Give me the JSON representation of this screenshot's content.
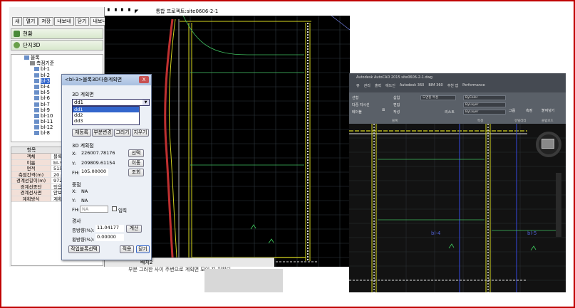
{
  "left_app": {
    "toolbar": [
      "새",
      "열기",
      "저장",
      "내보내",
      "닫기",
      "내보내기"
    ],
    "tab_current": "현황",
    "tab_3d": "단지3D",
    "tree_root": "블록",
    "tree_base": "측점기준",
    "tree_items": [
      "bl-1",
      "bl-2",
      "bl-3",
      "bl-4",
      "bl-5",
      "bl-6",
      "bl-7",
      "bl-9",
      "bl-10",
      "bl-11",
      "bl-12",
      "bl-8"
    ],
    "tree_selected": "bl-3",
    "props_header": {
      "key": "항목",
      "value": ""
    },
    "props": [
      {
        "k": "객체",
        "v": "블록"
      },
      {
        "k": "이름",
        "v": "bl-3"
      },
      {
        "k": "면적",
        "v": "5154"
      },
      {
        "k": "측점간격(m)",
        "v": "20.0"
      },
      {
        "k": "경계선길이(m)",
        "v": "972."
      },
      {
        "k": "경계선종단",
        "v": "있음"
      },
      {
        "k": "경계선사면",
        "v": "안보"
      },
      {
        "k": "계획방식",
        "v": "계획"
      }
    ]
  },
  "cad": {
    "title": "통합 프로젝트:site0606-2-1",
    "bottom_tab": "배치2",
    "under_text": "부분   그러한  사이 주변으로 계획면 모이 지 원하다"
  },
  "dialog": {
    "title": "<bl-3>블록3D다중계획면",
    "close": "X",
    "section_plan": "3D 계획면",
    "combo_value": "dd1",
    "list_items": [
      "dd1",
      "dd2",
      "dd3"
    ],
    "list_selected": "dd1",
    "btn_register": "재등록",
    "btn_partial": "부분변경",
    "btn_draw": "그리기",
    "btn_delete": "지우기",
    "section_point": "3D 계획점",
    "x_label": "X:",
    "x_value": "226007.78176",
    "btn_select": "선택",
    "y_label": "Y:",
    "y_value": "209809.61154",
    "btn_move": "이동",
    "fh_label": "FH:",
    "fh_value": "105.00000",
    "btn_view": "조회",
    "section_center": "중점",
    "cx_label": "X:",
    "cx_value": "NA",
    "cy_label": "Y:",
    "cy_value": "NA",
    "cfh_label": "FH:",
    "cfh_value": "NA",
    "input_label": "입력",
    "section_slope": "경사",
    "slope_v_label": "종방향(%):",
    "slope_v_value": "11.04177",
    "btn_calc": "계산",
    "slope_h_label": "횡방향(%):",
    "slope_h_value": "0.00000",
    "btn_work": "작업블록선택",
    "btn_apply": "적용",
    "btn_close": "닫기"
  },
  "acad": {
    "window_title": "Autodesk AutoCAD 2015  site0606-2-1.dwg",
    "menu": [
      "뷰",
      "관리",
      "출력",
      "애드인",
      "Autodesk 360",
      "BIM 360",
      "추천 앱",
      "Performance"
    ],
    "ribbon_left": [
      "선형",
      "다중 지시선",
      "테이블"
    ],
    "ribbon_layer": "도면층 특성",
    "layer_name": "ByLayer",
    "color_name": "ByColor",
    "linetype": "ByLayer",
    "lineweight": "ByLayer",
    "list_label": "리스트",
    "section_annot": "주석",
    "section_layer": "도면층",
    "section_block": "블록",
    "section_props": "특성",
    "section_group": "그룹",
    "section_utility": "유틸리티",
    "section_clip": "클립보드",
    "btn_insert": "삽입",
    "btn_edit": "편집",
    "btn_create": "작성",
    "btn_match": "특성 일치",
    "btn_group": "그룹",
    "btn_measure": "측정",
    "btn_paste": "붙여넣기",
    "label_bl4": "bl-4",
    "label_bl5": "bl-5"
  }
}
